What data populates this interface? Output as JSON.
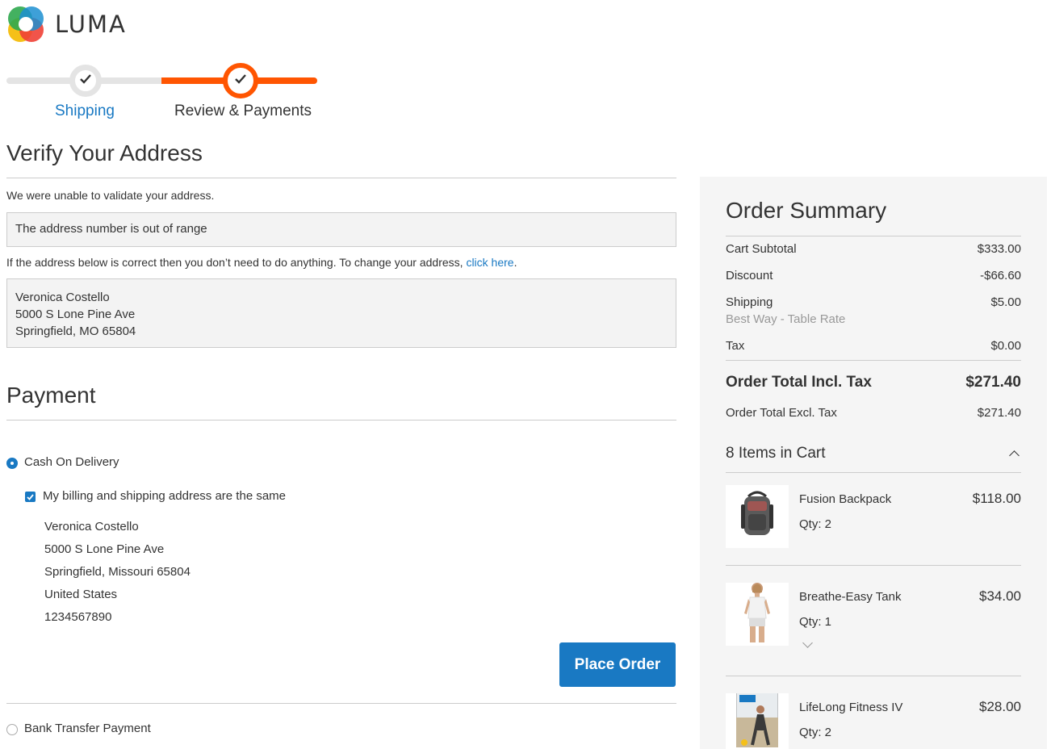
{
  "brand": {
    "name": "LUMA"
  },
  "progress": {
    "steps": [
      {
        "label": "Shipping",
        "state": "complete"
      },
      {
        "label": "Review & Payments",
        "state": "active"
      }
    ]
  },
  "verify": {
    "title": "Verify Your Address",
    "unable_text": "We were unable to validate your address.",
    "error_message": "The address number is out of range",
    "instruction_text": "If the address below is correct then you don’t need to do anything. To change your address,",
    "change_link": "click here",
    "instruction_tail": ".",
    "address": {
      "name": "Veronica Costello",
      "street": "5000 S Lone Pine Ave",
      "city_line": "Springfield, MO 65804"
    }
  },
  "payment": {
    "title": "Payment",
    "methods": [
      {
        "label": "Cash On Delivery",
        "selected": true
      },
      {
        "label": "Bank Transfer Payment",
        "selected": false
      }
    ],
    "same_address_label": "My billing and shipping address are the same",
    "same_address_checked": true,
    "billing_address": {
      "name": "Veronica Costello",
      "street": "5000 S Lone Pine Ave",
      "city_line": "Springfield, Missouri 65804",
      "country": "United States",
      "phone": "1234567890"
    },
    "place_order_label": "Place Order"
  },
  "summary": {
    "title": "Order Summary",
    "rows": {
      "subtotal": {
        "label": "Cart Subtotal",
        "value": "$333.00"
      },
      "discount": {
        "label": "Discount",
        "value": "-$66.60"
      },
      "shipping": {
        "label": "Shipping",
        "value": "$5.00",
        "method": "Best Way - Table Rate"
      },
      "tax": {
        "label": "Tax",
        "value": "$0.00"
      },
      "total_incl": {
        "label": "Order Total Incl. Tax",
        "value": "$271.40"
      },
      "total_excl": {
        "label": "Order Total Excl. Tax",
        "value": "$271.40"
      }
    },
    "items_header": "8 Items in Cart",
    "items": [
      {
        "name": "Fusion Backpack",
        "qty": "Qty: 2",
        "price": "$118.00",
        "image": "backpack"
      },
      {
        "name": "Breathe-Easy Tank",
        "qty": "Qty: 1",
        "price": "$34.00",
        "image": "tank-top"
      },
      {
        "name": "LifeLong Fitness IV",
        "qty": "Qty: 2",
        "price": "$28.00",
        "image": "dvd-cover"
      }
    ]
  },
  "colors": {
    "accent_blue": "#1979c3",
    "progress_orange": "#ff5501",
    "progress_grey": "#e4e4e4",
    "summary_bg": "#f5f5f5"
  }
}
